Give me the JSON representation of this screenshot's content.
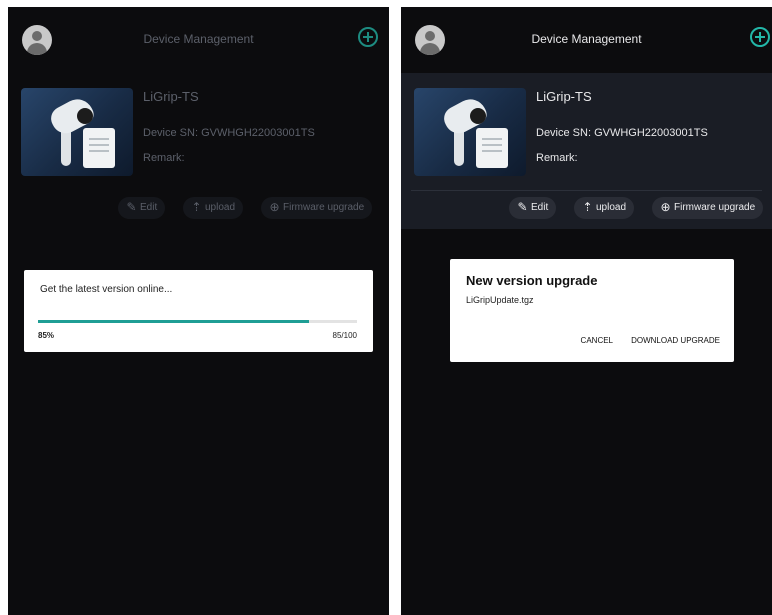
{
  "left": {
    "header": {
      "title": "Device Management"
    },
    "device": {
      "name": "LiGrip-TS",
      "sn": "Device SN: GVWHGH22003001TS",
      "remark": "Remark:"
    },
    "actions": {
      "edit": "Edit",
      "upload": "upload",
      "firmware": "Firmware upgrade"
    },
    "progress_dialog": {
      "message": "Get the latest version online...",
      "percent_label": "85%",
      "count_label": "85/100",
      "value": 0.85
    }
  },
  "right": {
    "header": {
      "title": "Device Management"
    },
    "device": {
      "name": "LiGrip-TS",
      "sn": "Device SN: GVWHGH22003001TS",
      "remark": "Remark:"
    },
    "actions": {
      "edit": "Edit",
      "upload": "upload",
      "firmware": "Firmware upgrade"
    },
    "upgrade_dialog": {
      "title": "New version upgrade",
      "file": "LiGripUpdate.tgz",
      "cancel": "CANCEL",
      "download": "DOWNLOAD UPGRADE"
    }
  },
  "colors": {
    "accent": "#23b7a8",
    "progress": "#1f9e95",
    "background": "#0c0c0e"
  },
  "icons": [
    "avatar-icon",
    "add-circle-icon",
    "edit-icon",
    "upload-icon",
    "firmware-upgrade-icon"
  ]
}
